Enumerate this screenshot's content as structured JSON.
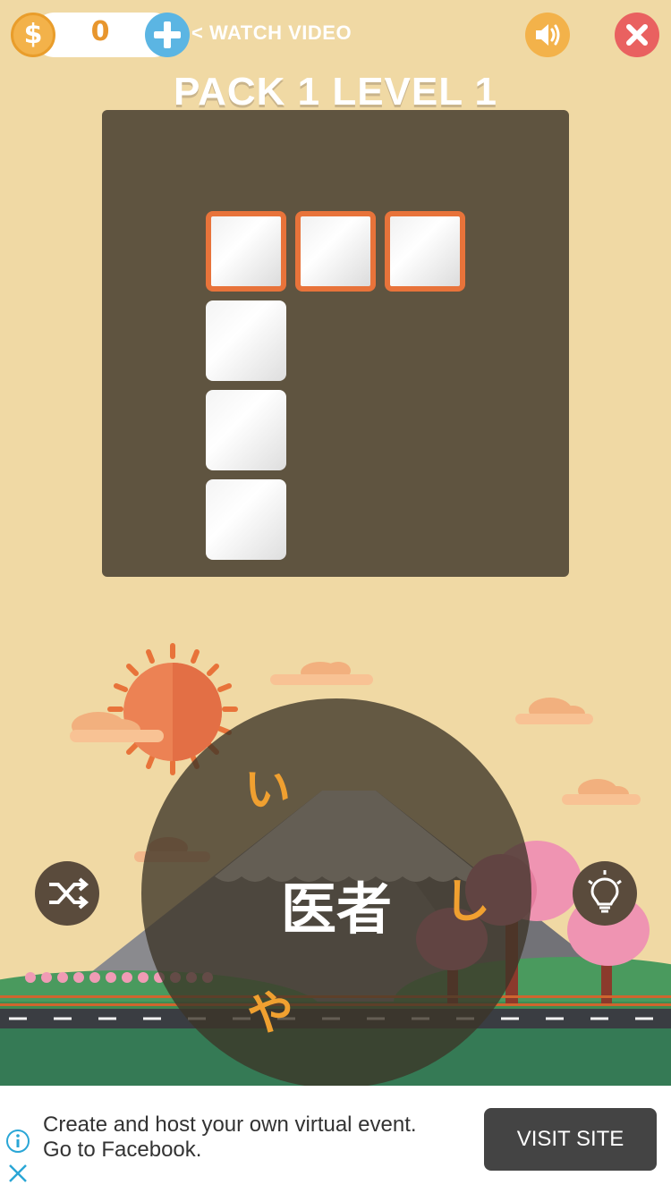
{
  "header": {
    "coin_count": "0",
    "coin_icon": "dollar-icon",
    "watch_video_label": "< WATCH VIDEO",
    "level_title": "PACK 1 LEVEL 1"
  },
  "wheel": {
    "hint": "医者",
    "letters": [
      "い",
      "し",
      "や"
    ]
  },
  "controls": {
    "shuffle_icon": "shuffle-icon",
    "hint_icon": "lightbulb-icon",
    "sound_icon": "speaker-icon",
    "close_icon": "close-icon",
    "add_icon": "plus-icon"
  },
  "ad": {
    "text": "Create and host your own virtual event. Go to Facebook.",
    "button_label": "VISIT SITE",
    "info_icon": "info-icon",
    "close_icon": "close-icon"
  },
  "colors": {
    "background": "#f0d9a4",
    "board": "#5f5440",
    "accent_orange": "#e8733a",
    "letter_color": "#f0a030"
  }
}
